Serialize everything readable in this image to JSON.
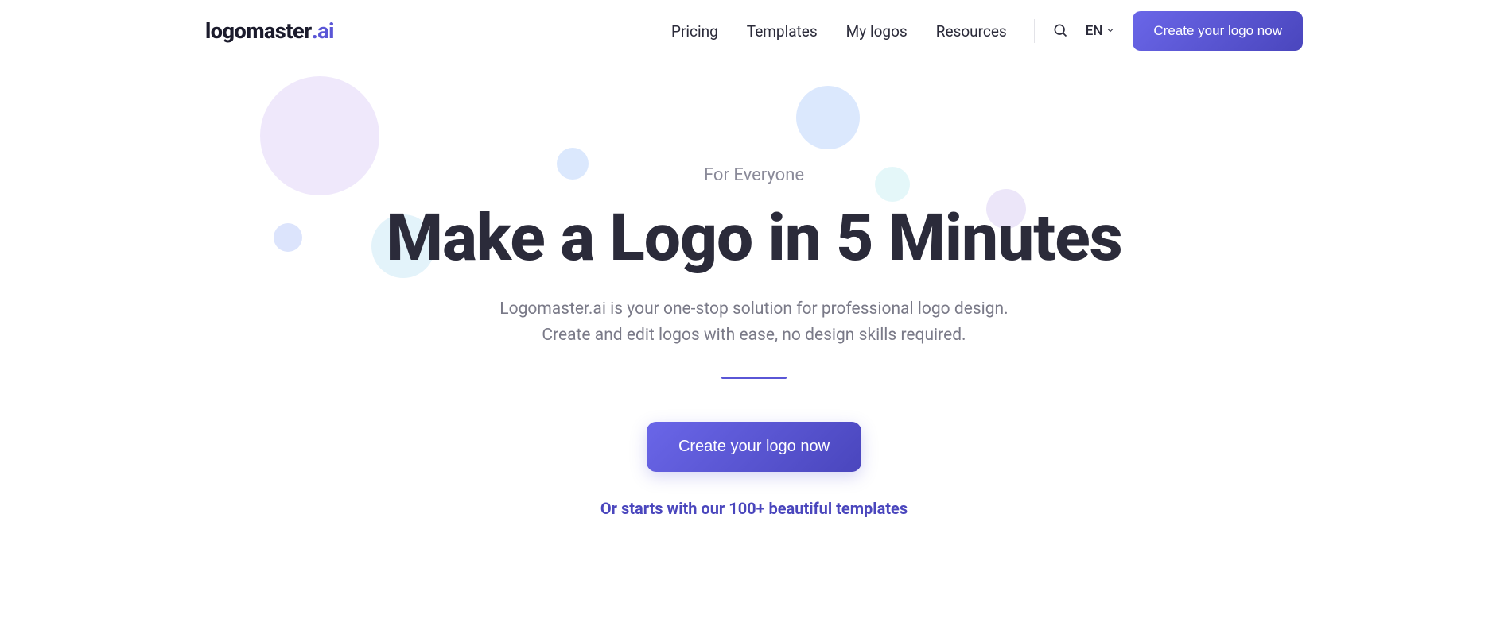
{
  "header": {
    "logo": {
      "main": "logomaster",
      "dot": ".",
      "suffix": "ai"
    },
    "nav": [
      {
        "label": "Pricing"
      },
      {
        "label": "Templates"
      },
      {
        "label": "My logos"
      },
      {
        "label": "Resources"
      }
    ],
    "language": "EN",
    "cta_label": "Create your logo now"
  },
  "hero": {
    "eyebrow": "For Everyone",
    "title": "Make a Logo in 5 Minutes",
    "sub_line1": "Logomaster.ai is your one-stop solution for professional logo design.",
    "sub_line2": "Create and edit logos with ease, no design skills required.",
    "cta_label": "Create your logo now",
    "templates_link": "Or starts with our 100+ beautiful templates"
  }
}
